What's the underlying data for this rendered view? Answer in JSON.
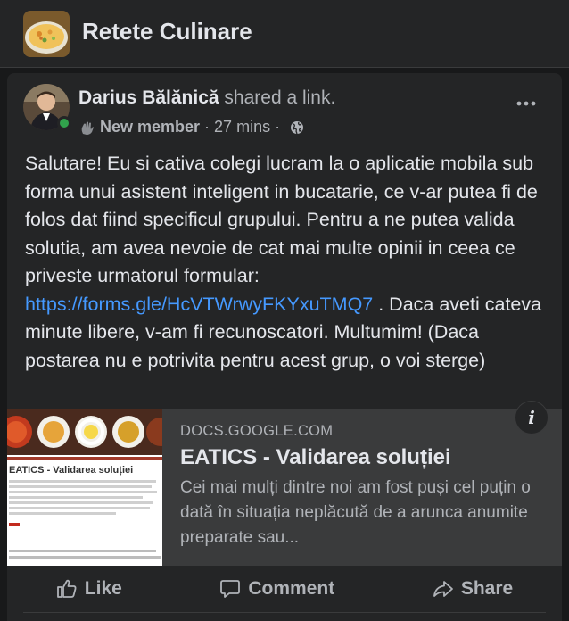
{
  "group": {
    "title": "Retete Culinare",
    "thumb_icon": "soup-bowl-image"
  },
  "post": {
    "author": "Darius Bălănică",
    "action": "shared a link.",
    "badge": "New member",
    "separator": "·",
    "time": "27 mins",
    "separator2": "·",
    "audience_icon": "globe-icon",
    "text_before_link": "Salutare! Eu si cativa colegi lucram la o aplicatie mobila sub forma unui asistent inteligent in bucatarie, ce v-ar putea fi de folos dat fiind specificul grupului. Pentru a ne putea valida solutia, am avea nevoie de cat mai multe opinii in ceea ce priveste urmatorul formular: ",
    "link_text": "https://forms.gle/HcVTWrwyFKYxuTMQ7",
    "text_after_link": " . Daca aveti cateva minute libere, v-am fi recunoscatori. Multumim! (Daca postarea nu e potrivita pentru acest grup, o voi sterge)"
  },
  "preview": {
    "domain": "DOCS.GOOGLE.COM",
    "title": "EATICS - Validarea soluției",
    "description": "Cei mai mulți dintre noi am fost puși cel puțin o dată în situația neplăcută de a arunca anumite preparate sau...",
    "image_heading": "EATICS - Validarea soluției",
    "info_glyph": "i"
  },
  "actions": {
    "like": "Like",
    "comment": "Comment",
    "share": "Share"
  },
  "colors": {
    "background": "#18191a",
    "card": "#242526",
    "link": "#4599ff",
    "online": "#31a24c"
  }
}
